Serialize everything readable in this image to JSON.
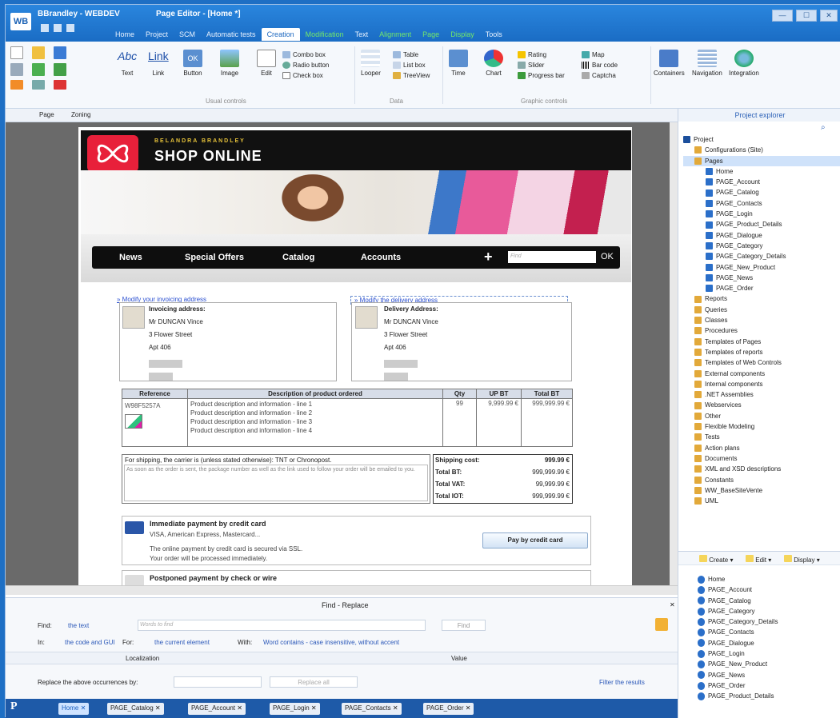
{
  "window": {
    "app_title": "BBrandley - WEBDEV",
    "page_title": "Page Editor - [Home *]",
    "logo": "WB",
    "controls": {
      "minimize": "—",
      "maximize": "☐",
      "close": "✕"
    }
  },
  "menu": [
    "Home",
    "Project",
    "SCM",
    "Automatic tests",
    "Creation",
    "Modification",
    "Text",
    "Alignment",
    "Page",
    "Display",
    "Tools"
  ],
  "menu_active": "Creation",
  "ribbon": {
    "text": "Text",
    "link": "Link",
    "button": "Button",
    "image": "Image",
    "edit": "Edit",
    "combo": "Combo box",
    "radio": "Radio button",
    "check": "Check box",
    "looper": "Looper",
    "table": "Table",
    "listbox": "List box",
    "treeview": "TreeView",
    "time": "Time",
    "chart": "Chart",
    "rating": "Rating",
    "slider": "Slider",
    "progress": "Progress bar",
    "map": "Map",
    "barcode": "Bar code",
    "captcha": "Captcha",
    "containers": "Containers",
    "navigation": "Navigation",
    "integration": "Integration",
    "group_visual": "Usual controls",
    "group_data": "Data",
    "group_graphic": "Graphic controls",
    "abc": "Abc",
    "link_big": "Link",
    "ok": "OK"
  },
  "editor_tabs": {
    "page": "Page",
    "zoning": "Zoning"
  },
  "shop": {
    "brand": "BELANDRA BRANDLEY",
    "title": "SHOP ONLINE",
    "nav": [
      "News",
      "Special Offers",
      "Catalog",
      "Accounts"
    ],
    "plus": "+",
    "find_placeholder": "Find",
    "ok": "OK",
    "modify_invoice": "» Modify your invoicing address",
    "modify_delivery": "» Modify the delivery address",
    "invoice_title": "Invoicing address:",
    "delivery_title": "Delivery Address:",
    "address": [
      "Mr DUNCAN Vince",
      "3 Flower Street",
      "Apt 406"
    ],
    "table_headers": [
      "Reference",
      "Description of product ordered",
      "Qty",
      "UP BT",
      "Total BT"
    ],
    "row": {
      "ref": "W98F5257A",
      "desc": [
        "Product description and information - line 1",
        "Product description and information - line 2",
        "Product description and information - line 3",
        "Product description and information - line 4"
      ],
      "qty": "99",
      "up": "9,999.99 €",
      "total": "999,999.99 €"
    },
    "shipping_note": "For shipping, the carrier is (unless stated otherwise): TNT or Chronopost.",
    "shipping_info": "As soon as the order is sent, the package number as well as the link used to follow your order will be emailed to you.",
    "summary": [
      {
        "label": "Shipping cost:",
        "value": "999.99 €"
      },
      {
        "label": "Total BT:",
        "value": "999,999.99 €"
      },
      {
        "label": "Total VAT:",
        "value": "99,999.99 €"
      },
      {
        "label": "Total IOT:",
        "value": "999,999.99 €"
      }
    ],
    "pay1_title": "Immediate payment by credit card",
    "pay1_cards": "VISA, American Express, Mastercard...",
    "pay1_note1": "The online payment by credit card is secured via SSL.",
    "pay1_note2": "Your order will be processed immediately.",
    "pay1_button": "Pay by credit card",
    "pay2_title": "Postponed payment by check or wire"
  },
  "find_panel": {
    "title": "Find - Replace",
    "find_label": "Find:",
    "the_text": "the text",
    "words_placeholder": "Words to find",
    "find_btn": "Find",
    "in_label": "In:",
    "in_value": "the code and GUI",
    "for_label": "For:",
    "for_value": "the current element",
    "with_label": "With:",
    "with_value": "Word contains - case insensitive, without accent",
    "col_localization": "Localization",
    "col_value": "Value",
    "replace_label": "Replace the above occurrences by:",
    "replace_all": "Replace all",
    "filter": "Filter the results"
  },
  "bottom_tabs": [
    "Home",
    "PAGE_Catalog",
    "PAGE_Account",
    "PAGE_Login",
    "PAGE_Contacts",
    "PAGE_Order"
  ],
  "project_explorer": {
    "title": "Project explorer",
    "tree": [
      {
        "label": "Project",
        "level": 0
      },
      {
        "label": "Configurations (Site)",
        "level": 1
      },
      {
        "label": "Pages",
        "level": 1,
        "selected": true
      },
      {
        "label": "Home",
        "level": 2
      },
      {
        "label": "PAGE_Account",
        "level": 2
      },
      {
        "label": "PAGE_Catalog",
        "level": 2
      },
      {
        "label": "PAGE_Contacts",
        "level": 2
      },
      {
        "label": "PAGE_Login",
        "level": 2
      },
      {
        "label": "PAGE_Product_Details",
        "level": 2
      },
      {
        "label": "PAGE_Dialogue",
        "level": 2
      },
      {
        "label": "PAGE_Category",
        "level": 2
      },
      {
        "label": "PAGE_Category_Details",
        "level": 2
      },
      {
        "label": "PAGE_New_Product",
        "level": 2
      },
      {
        "label": "PAGE_News",
        "level": 2
      },
      {
        "label": "PAGE_Order",
        "level": 2
      },
      {
        "label": "Reports",
        "level": 1
      },
      {
        "label": "Queries",
        "level": 1
      },
      {
        "label": "Classes",
        "level": 1
      },
      {
        "label": "Procedures",
        "level": 1
      },
      {
        "label": "Templates of Pages",
        "level": 1
      },
      {
        "label": "Templates of reports",
        "level": 1
      },
      {
        "label": "Templates of Web Controls",
        "level": 1
      },
      {
        "label": "External components",
        "level": 1
      },
      {
        "label": "Internal components",
        "level": 1
      },
      {
        "label": ".NET Assemblies",
        "level": 1
      },
      {
        "label": "Webservices",
        "level": 1
      },
      {
        "label": "Other",
        "level": 1
      },
      {
        "label": "Flexible Modeling",
        "level": 1
      },
      {
        "label": "Tests",
        "level": 1
      },
      {
        "label": "Action plans",
        "level": 1
      },
      {
        "label": "Documents",
        "level": 1
      },
      {
        "label": "XML and XSD descriptions",
        "level": 1
      },
      {
        "label": "Constants",
        "level": 1
      },
      {
        "label": "WW_BaseSiteVente",
        "level": 1
      },
      {
        "label": "UML",
        "level": 1
      }
    ],
    "toolbar": {
      "create": "Create",
      "edit": "Edit",
      "display": "Display"
    },
    "page_list": [
      "Home",
      "PAGE_Account",
      "PAGE_Catalog",
      "PAGE_Category",
      "PAGE_Category_Details",
      "PAGE_Contacts",
      "PAGE_Dialogue",
      "PAGE_Login",
      "PAGE_New_Product",
      "PAGE_News",
      "PAGE_Order",
      "PAGE_Product_Details"
    ]
  },
  "colors": {
    "accent": "#1e6fc4",
    "brand_red": "#e8203a"
  }
}
